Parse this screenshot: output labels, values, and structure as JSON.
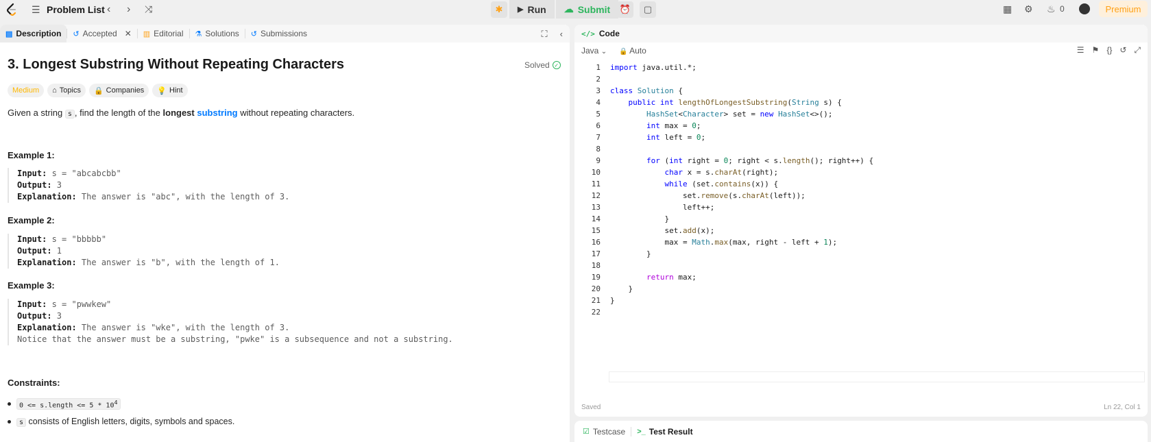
{
  "topbar": {
    "problem_list": "Problem List",
    "run": "Run",
    "submit": "Submit",
    "streak_count": "0",
    "premium": "Premium"
  },
  "left_tabs": [
    {
      "label": "Description"
    },
    {
      "label": "Accepted"
    },
    {
      "label": "Editorial"
    },
    {
      "label": "Solutions"
    },
    {
      "label": "Submissions"
    }
  ],
  "problem": {
    "title": "3. Longest Substring Without Repeating Characters",
    "solved": "Solved",
    "difficulty": "Medium",
    "chips": [
      "Topics",
      "Companies",
      "Hint"
    ],
    "statement_pre": "Given a string ",
    "statement_var": "s",
    "statement_mid": ", find the length of the ",
    "statement_bold": "longest",
    "statement_link": "substring",
    "statement_post": " without repeating characters."
  },
  "examples": [
    {
      "heading": "Example 1:",
      "input_label": "Input:",
      "input": " s = \"abcabcbb\"",
      "output_label": "Output:",
      "output": " 3",
      "expl_label": "Explanation:",
      "expl": " The answer is \"abc\", with the length of 3.",
      "note": ""
    },
    {
      "heading": "Example 2:",
      "input_label": "Input:",
      "input": " s = \"bbbbb\"",
      "output_label": "Output:",
      "output": " 1",
      "expl_label": "Explanation:",
      "expl": " The answer is \"b\", with the length of 1.",
      "note": ""
    },
    {
      "heading": "Example 3:",
      "input_label": "Input:",
      "input": " s = \"pwwkew\"",
      "output_label": "Output:",
      "output": " 3",
      "expl_label": "Explanation:",
      "expl": " The answer is \"wke\", with the length of 3.",
      "note": "Notice that the answer must be a substring, \"pwke\" is a subsequence and not a substring."
    }
  ],
  "constraints": {
    "heading": "Constraints:",
    "c1_code": "0 <= s.length <= 5 * 10",
    "c1_sup": "4",
    "c2_code": "s",
    "c2_text": " consists of English letters, digits, symbols and spaces."
  },
  "code_panel": {
    "title": "Code",
    "language": "Java",
    "mode": "Auto",
    "saved": "Saved",
    "cursor": "Ln 22, Col 1"
  },
  "code_lines": [
    "import java.util.*;",
    "",
    "class Solution {",
    "    public int lengthOfLongestSubstring(String s) {",
    "        HashSet<Character> set = new HashSet<>();",
    "        int max = 0;",
    "        int left = 0;",
    "",
    "        for (int right = 0; right < s.length(); right++) {",
    "            char x = s.charAt(right);",
    "            while (set.contains(x)) {",
    "                set.remove(s.charAt(left));",
    "                left++;",
    "            }",
    "            set.add(x);",
    "            max = Math.max(max, right - left + 1);",
    "        }",
    "",
    "        return max;",
    "    }",
    "}",
    ""
  ],
  "bottom_tabs": {
    "testcase": "Testcase",
    "test_result": "Test Result"
  }
}
